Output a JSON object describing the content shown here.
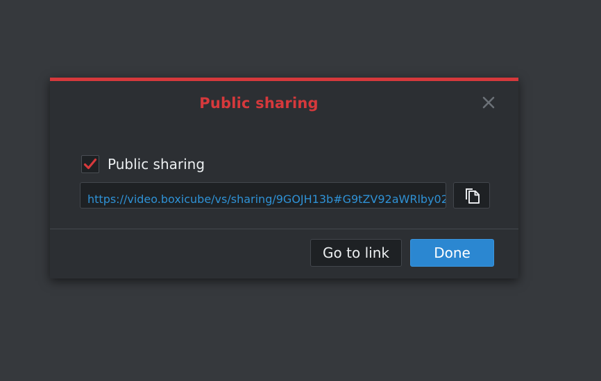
{
  "dialog": {
    "title": "Public sharing",
    "close_icon": "close-icon",
    "accent_color": "#d6393c"
  },
  "public_sharing": {
    "checkbox_checked": true,
    "label": "Public sharing",
    "check_icon": "checkmark-icon"
  },
  "share_link": {
    "url": "https://video.boxicube/vs/sharing/9GOJH13b#G9tZV92aWRlby02",
    "copy_icon": "copy-icon",
    "link_color": "#2f92d6"
  },
  "footer": {
    "go_to_link_label": "Go to link",
    "done_label": "Done",
    "done_color": "#2b87d1"
  }
}
